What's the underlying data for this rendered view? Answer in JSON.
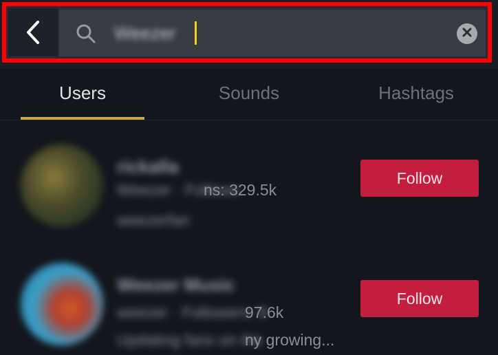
{
  "search": {
    "query": "Weezer",
    "back_icon": "chevron-left-icon",
    "search_icon": "search-icon",
    "clear_icon": "clear-circle-icon"
  },
  "tabs": [
    {
      "label": "Users",
      "active": true
    },
    {
      "label": "Sounds",
      "active": false
    },
    {
      "label": "Hashtags",
      "active": false
    }
  ],
  "users": [
    {
      "name": "rickalla",
      "stats_hidden": "Weezer · Follows",
      "stats_visible": "ns: 329.5k",
      "bio_hidden": "weezerfan",
      "bio_visible": "",
      "follow_label": "Follow"
    },
    {
      "name": "Weezer Music",
      "stats_hidden": "weezer · Followers: 8",
      "stats_visible": "97.6k",
      "bio_hidden": "Updating fans on the",
      "bio_visible": "ny growing...",
      "follow_label": "Follow"
    }
  ],
  "colors": {
    "background": "#14161d",
    "highlight": "#ff0000",
    "follow_button": "#c41e3f",
    "tab_underline": "#c9a94b",
    "caret": "#f2d320"
  }
}
